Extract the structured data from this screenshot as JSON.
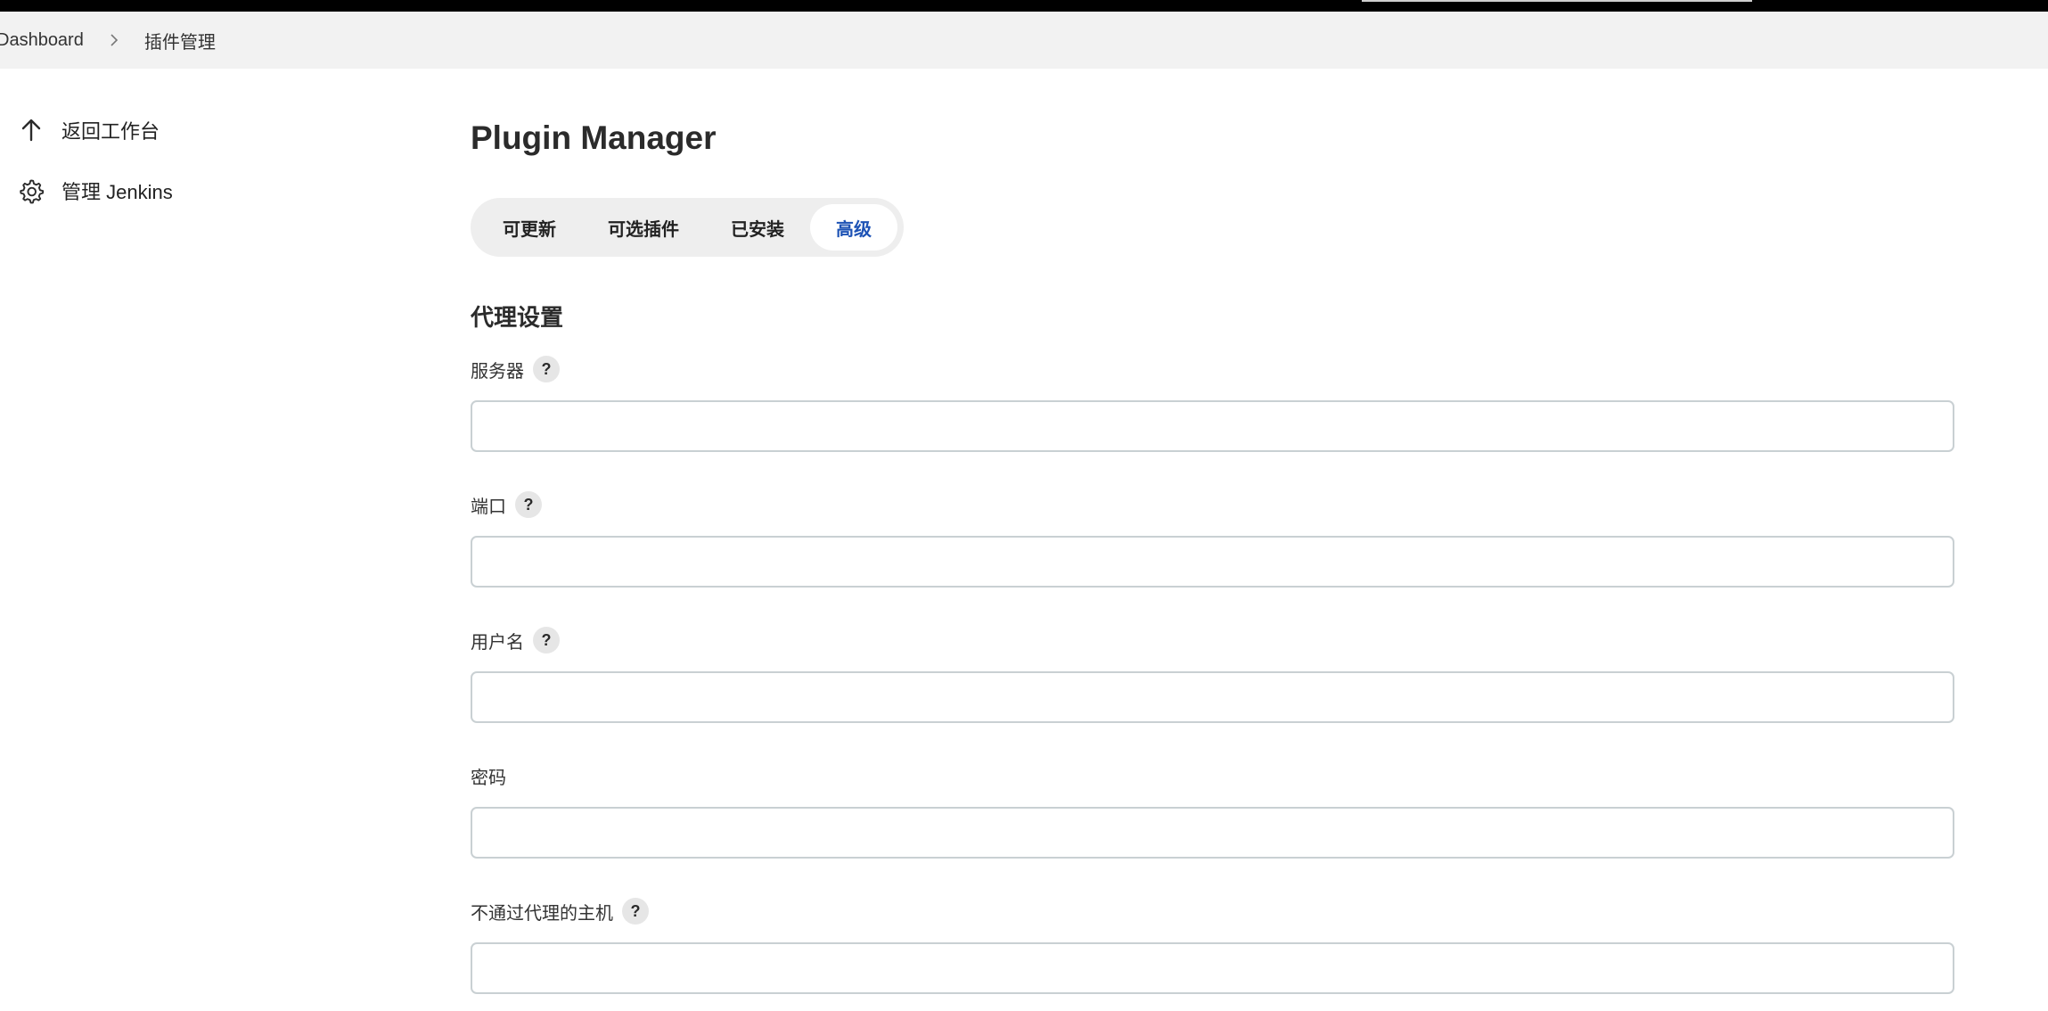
{
  "breadcrumb": {
    "items": [
      "Dashboard",
      "插件管理"
    ]
  },
  "sidebar": {
    "items": [
      {
        "label": "返回工作台",
        "icon": "arrow-up-icon"
      },
      {
        "label": "管理 Jenkins",
        "icon": "gear-icon"
      }
    ]
  },
  "main": {
    "title": "Plugin Manager",
    "tabs": [
      {
        "label": "可更新",
        "active": false
      },
      {
        "label": "可选插件",
        "active": false
      },
      {
        "label": "已安装",
        "active": false
      },
      {
        "label": "高级",
        "active": true
      }
    ],
    "section_title": "代理设置",
    "fields": [
      {
        "label": "服务器",
        "help": "?",
        "value": ""
      },
      {
        "label": "端口",
        "help": "?",
        "value": ""
      },
      {
        "label": "用户名",
        "help": "?",
        "value": ""
      },
      {
        "label": "密码",
        "value": ""
      },
      {
        "label": "不通过代理的主机",
        "help": "?",
        "value": ""
      }
    ]
  },
  "colors": {
    "active_tab_text": "#1e53b5",
    "breadcrumb_bg": "#f2f2f2",
    "tab_bar_bg": "#eeeeee",
    "input_border": "#c9d0d3"
  }
}
